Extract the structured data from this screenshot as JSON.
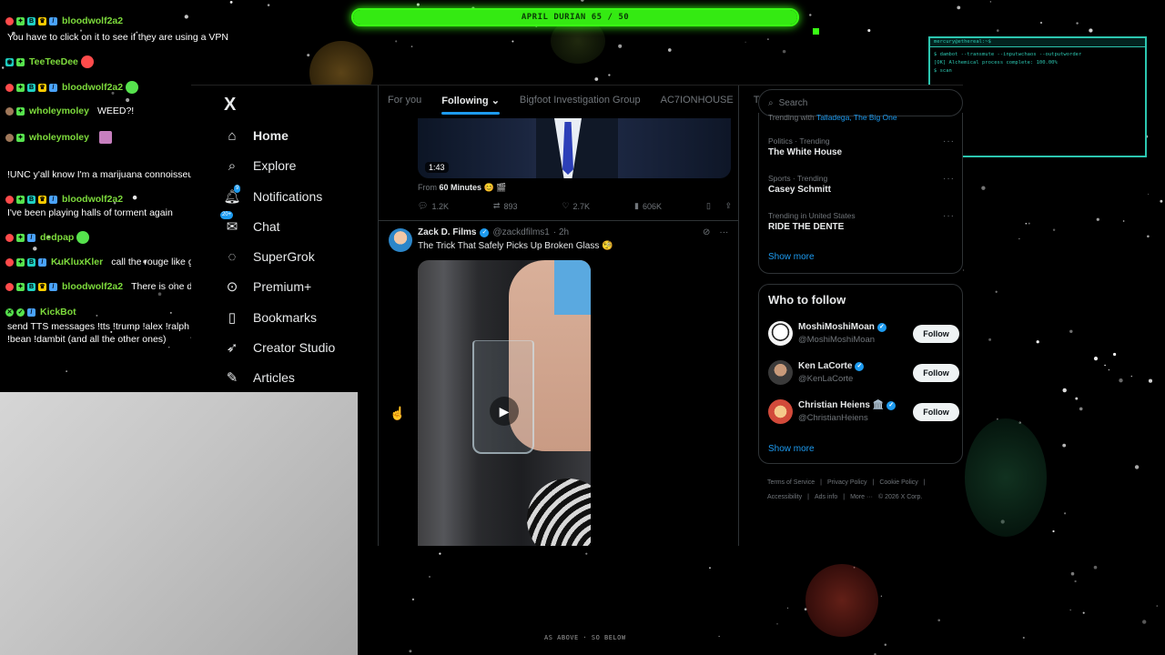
{
  "overlay": {
    "progress_label": "APRIL DURIAN 65 / 50",
    "progress_fraction": 1.0,
    "bottom_caption": "AS ABOVE · SO BELOW",
    "terminal": {
      "title": "mercury@ethereal:~$",
      "lines": [
        "$ dambot --transmute --inputwchaos --outputworder",
        "[OK] Alchemical process complete: 100.00%",
        "$ scan"
      ]
    }
  },
  "chat": [
    {
      "user": "bloodwolf2a2",
      "message": ""
    },
    {
      "user": "",
      "message": "You have to click on it to see if they are using a VPN"
    },
    {
      "user": "TeeTeeDee",
      "message": ""
    },
    {
      "user": "bloodwolf2a2",
      "message": ""
    },
    {
      "user": "wholeymoley",
      "message": "WEED?!"
    },
    {
      "user": "wholeymoley",
      "message": ""
    },
    {
      "user": "",
      "message": "!UNC y'all know I'm a marijuana connoisseur"
    },
    {
      "user": "bloodwolf2a2",
      "message": ""
    },
    {
      "user": "",
      "message": "I've been playing halls of torment again"
    },
    {
      "user": "dedpap",
      "message": ""
    },
    {
      "user": "KuKluxKler",
      "message": "call the rouge like geno's quest"
    },
    {
      "user": "bloodwolf2a2",
      "message": "There is one dlc"
    },
    {
      "user": "KickBot",
      "message": ""
    },
    {
      "user": "",
      "message": "send TTS messages !tts !trump !alex !ralph !njf !tucker !teddy"
    },
    {
      "user": "",
      "message": "!bean !dambit (and all the other ones)"
    }
  ],
  "nav": {
    "logo": "X",
    "items": [
      "Home",
      "Explore",
      "Notifications",
      "Chat",
      "SuperGrok",
      "Premium+",
      "Bookmarks",
      "Creator Studio",
      "Articles"
    ],
    "notif_badge": "9",
    "chat_badge": "20+"
  },
  "feed": {
    "tabs": [
      "For you",
      "Following",
      "Bigfoot Investigation Group",
      "AC7IONHOUSE",
      "T"
    ],
    "post1": {
      "duration": "1:43",
      "from_prefix": "From",
      "from_source": "60 Minutes",
      "replies": "1.2K",
      "reposts": "893",
      "likes": "2.7K",
      "views": "606K"
    },
    "post2": {
      "name": "Zack D. Films",
      "handle": "@zackdfilms1",
      "time": "· 2h",
      "text": "The Trick That Safely Picks Up Broken Glass 🧐"
    }
  },
  "sidebar": {
    "search_placeholder": "Search",
    "trend_top": {
      "prefix": "Trending with",
      "links": "Talladega, The Big One"
    },
    "trends": [
      {
        "category": "Politics · Trending",
        "title": "The White House"
      },
      {
        "category": "Sports · Trending",
        "title": "Casey Schmitt"
      },
      {
        "category": "Trending in United States",
        "title": "RIDE THE DENTE"
      }
    ],
    "show_more": "Show more",
    "who_to_follow": "Who to follow",
    "follow": [
      {
        "name": "MoshiMoshiMoan",
        "handle": "@MoshiMoshiMoan",
        "button": "Follow"
      },
      {
        "name": "Ken LaCorte",
        "handle": "@KenLaCorte",
        "button": "Follow"
      },
      {
        "name": "Christian Heiens 🏛️",
        "handle": "@ChristianHeiens",
        "button": "Follow"
      }
    ],
    "show_more_2": "Show more",
    "footer": [
      "Terms of Service",
      "|",
      "Privacy Policy",
      "|",
      "Cookie Policy",
      "|",
      "Accessibility",
      "|",
      "Ads info",
      "|",
      "More ···",
      "© 2026 X Corp."
    ]
  },
  "colors": {
    "accent": "#1d9bf0",
    "neon": "#39ff14",
    "terminal": "#2cc6b0"
  }
}
